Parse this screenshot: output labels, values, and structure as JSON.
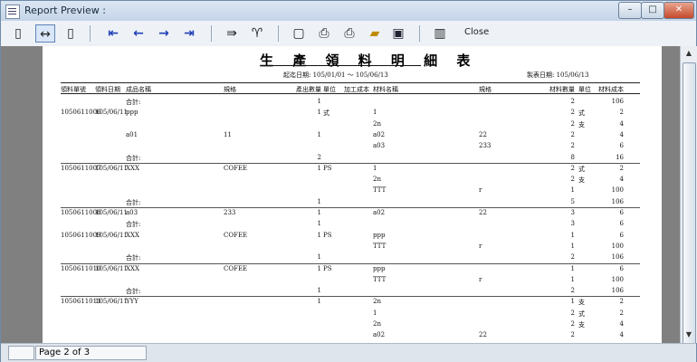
{
  "window": {
    "title": "Report Preview :"
  },
  "toolbar": {
    "close_label": "Close"
  },
  "report": {
    "title": "生 產 領 料 明 細 表",
    "date_range": "起迄日期:   105/01/01  ～ 105/06/13",
    "print_date": "製表日期:     105/06/13",
    "headers": [
      "領料單號",
      "領料日期",
      "成品名稱",
      "規格",
      "產出數量",
      "單位",
      "加工成本",
      "材料名稱",
      "規格",
      "材料數量",
      "單位",
      "材料成本"
    ],
    "rows": [
      {
        "c": [
          "",
          "",
          "合計:",
          "",
          "1",
          "",
          "",
          "",
          "",
          "2",
          "",
          "106"
        ]
      },
      {
        "c": [
          "1050611006",
          "105/06/11",
          "ppp",
          "",
          "1",
          "式",
          "",
          "1",
          "",
          "2",
          "式",
          "2"
        ]
      },
      {
        "c": [
          "",
          "",
          "",
          "",
          "",
          "",
          "",
          "2n",
          "",
          "2",
          "支",
          "4"
        ]
      },
      {
        "c": [
          "",
          "",
          "a01",
          "11",
          "1",
          "",
          "",
          "a02",
          "22",
          "2",
          "",
          "4"
        ]
      },
      {
        "c": [
          "",
          "",
          "",
          "",
          "",
          "",
          "",
          "a03",
          "233",
          "2",
          "",
          "6"
        ]
      },
      {
        "c": [
          "",
          "",
          "合計:",
          "",
          "2",
          "",
          "",
          "",
          "",
          "8",
          "",
          "16"
        ],
        "line": true
      },
      {
        "c": [
          "1050611007",
          "105/06/11",
          "XXX",
          "COFEE",
          "1",
          "PS",
          "",
          "1",
          "",
          "2",
          "式",
          "2"
        ]
      },
      {
        "c": [
          "",
          "",
          "",
          "",
          "",
          "",
          "",
          "2n",
          "",
          "2",
          "支",
          "4"
        ]
      },
      {
        "c": [
          "",
          "",
          "",
          "",
          "",
          "",
          "",
          "TTT",
          "r",
          "1",
          "",
          "100"
        ]
      },
      {
        "c": [
          "",
          "",
          "合計:",
          "",
          "1",
          "",
          "",
          "",
          "",
          "5",
          "",
          "106"
        ],
        "line": true
      },
      {
        "c": [
          "1050611008",
          "105/06/11",
          "a03",
          "233",
          "1",
          "",
          "",
          "a02",
          "22",
          "3",
          "",
          "6"
        ]
      },
      {
        "c": [
          "",
          "",
          "合計:",
          "",
          "1",
          "",
          "",
          "",
          "",
          "3",
          "",
          "6"
        ]
      },
      {
        "c": [
          "1050611009",
          "105/06/11",
          "XXX",
          "COFEE",
          "1",
          "PS",
          "",
          "ppp",
          "",
          "1",
          "",
          "6"
        ]
      },
      {
        "c": [
          "",
          "",
          "",
          "",
          "",
          "",
          "",
          "TTT",
          "r",
          "1",
          "",
          "100"
        ]
      },
      {
        "c": [
          "",
          "",
          "合計:",
          "",
          "1",
          "",
          "",
          "",
          "",
          "2",
          "",
          "106"
        ],
        "line": true
      },
      {
        "c": [
          "1050611010",
          "105/06/11",
          "XXX",
          "COFEE",
          "1",
          "PS",
          "",
          "ppp",
          "",
          "1",
          "",
          "6"
        ]
      },
      {
        "c": [
          "",
          "",
          "",
          "",
          "",
          "",
          "",
          "TTT",
          "r",
          "1",
          "",
          "100"
        ]
      },
      {
        "c": [
          "",
          "",
          "合計:",
          "",
          "1",
          "",
          "",
          "",
          "",
          "2",
          "",
          "106"
        ],
        "line": true
      },
      {
        "c": [
          "1050611011",
          "105/06/11",
          "YYY",
          "",
          "1",
          "",
          "",
          "2n",
          "",
          "1",
          "支",
          "2"
        ]
      },
      {
        "c": [
          "",
          "",
          "",
          "",
          "",
          "",
          "",
          "1",
          "",
          "2",
          "式",
          "2"
        ]
      },
      {
        "c": [
          "",
          "",
          "",
          "",
          "",
          "",
          "",
          "2n",
          "",
          "2",
          "支",
          "4"
        ]
      },
      {
        "c": [
          "",
          "",
          "",
          "",
          "",
          "",
          "",
          "a02",
          "22",
          "2",
          "",
          "4"
        ]
      }
    ]
  },
  "status": {
    "page": "Page 2 of 3"
  }
}
